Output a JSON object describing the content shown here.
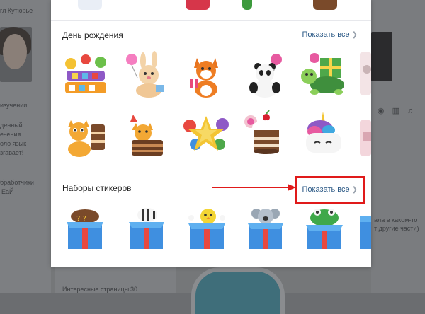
{
  "background": {
    "left_texts": [
      "гл Кутюрье",
      "изучении",
      "денный",
      "ечения",
      "оло язык",
      "згавает!",
      "бработчики",
      "ЕаЙ"
    ],
    "right_texts": [
      "ала в каком-то",
      "т другие части)"
    ],
    "bottom_text": "Интересные страницы",
    "bottom_count": "30"
  },
  "modal": {
    "sections": [
      {
        "title": "День рождения",
        "show_all_label": "Показать все",
        "rows": [
          [
            "happy-birthday-balloons",
            "bunny-with-balloon",
            "fox-with-gift",
            "panda-with-balloon",
            "turtle-with-gift",
            "partial-sticker"
          ],
          [
            "cat-with-cake",
            "cat-in-cake",
            "star-balloon",
            "cupcake-with-cherry",
            "unicorn-cake",
            "partial-sticker"
          ]
        ]
      },
      {
        "title": "Наборы стикеров",
        "show_all_label": "Показать все",
        "rows": [
          [
            "mystery-box-chocolate",
            "mystery-box-zebra",
            "mystery-box-chick",
            "mystery-box-koala",
            "mystery-box-frog",
            "partial-sticker"
          ]
        ]
      }
    ]
  },
  "colors": {
    "link": "#2a5885",
    "annotation": "#e01a1a",
    "overlay": "#757779"
  }
}
